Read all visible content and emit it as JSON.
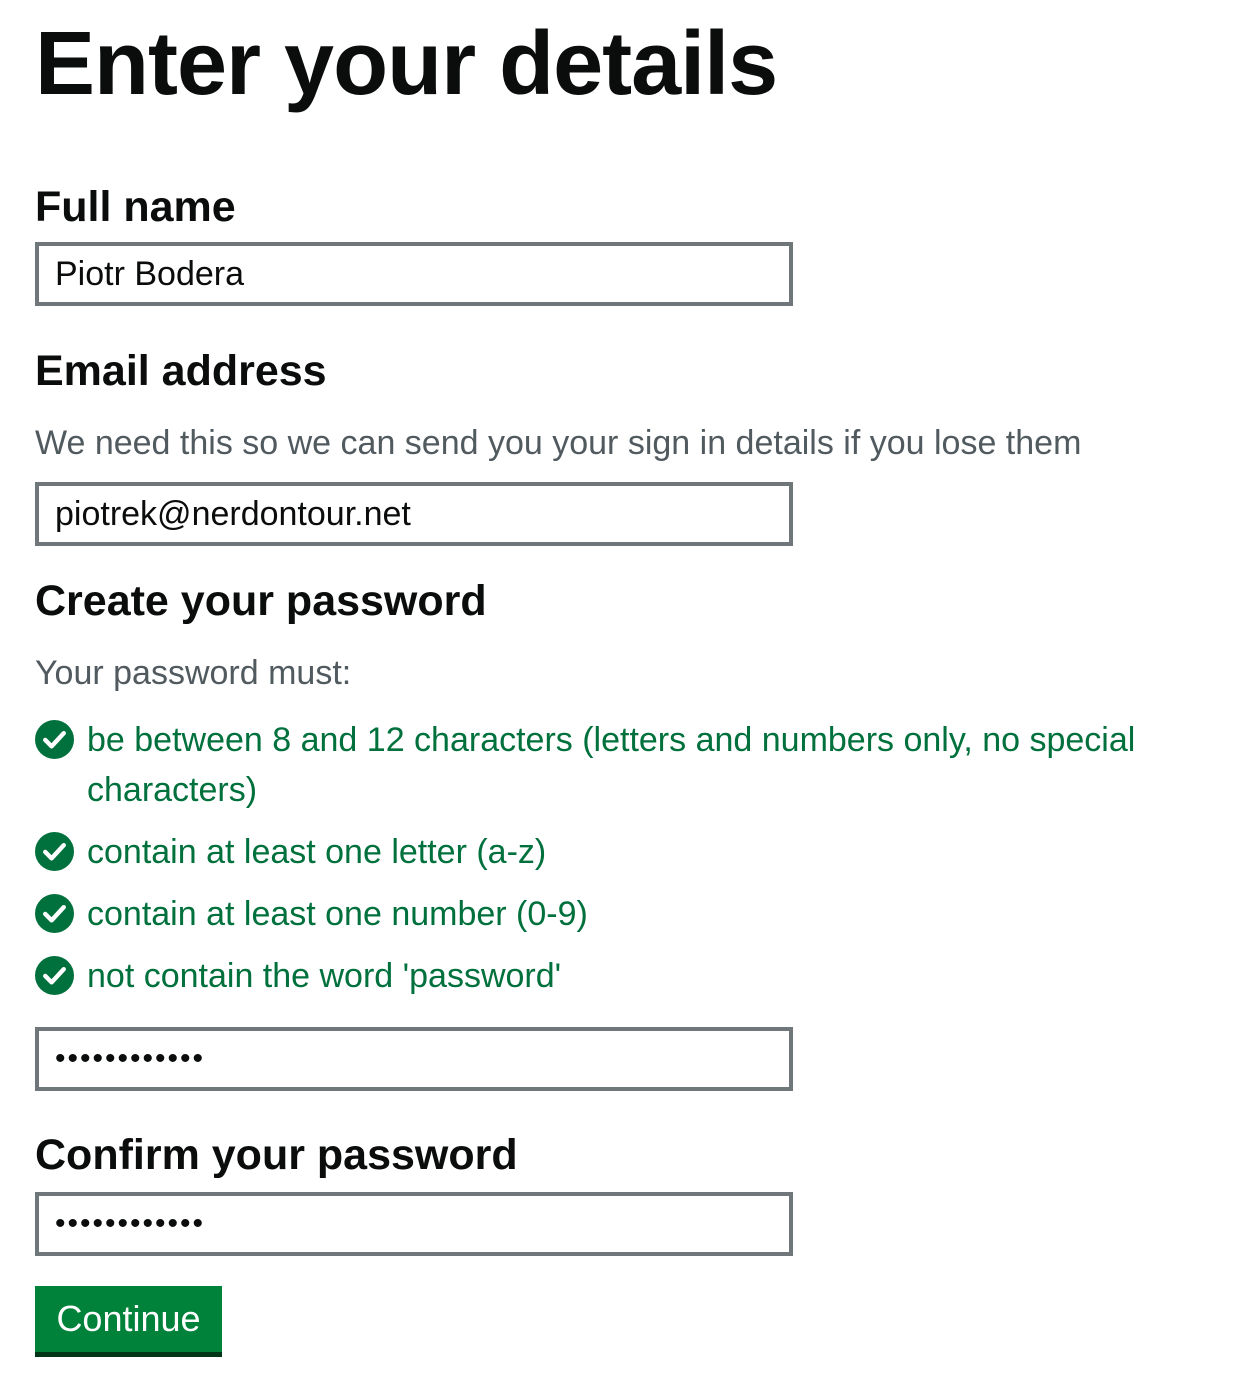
{
  "page": {
    "title": "Enter your details"
  },
  "full_name": {
    "label": "Full name",
    "value": "Piotr Bodera"
  },
  "email": {
    "label": "Email address",
    "hint": "We need this so we can send you your sign in details if you lose them",
    "value": "piotrek@nerdontour.net"
  },
  "password": {
    "label": "Create your password",
    "hint": "Your password must:",
    "requirements": [
      {
        "text": "be between 8 and 12 characters (letters and numbers only, no special characters)",
        "icon": "check-circle-icon",
        "met": true
      },
      {
        "text": "contain at least one letter (a-z)",
        "icon": "check-circle-icon",
        "met": true
      },
      {
        "text": "contain at least one number (0-9)",
        "icon": "check-circle-icon",
        "met": true
      },
      {
        "text": "not contain the word 'password'",
        "icon": "check-circle-icon",
        "met": true
      }
    ],
    "masked_value": "••••••••••••"
  },
  "confirm_password": {
    "label": "Confirm your password",
    "masked_value": "••••••••••••"
  },
  "actions": {
    "continue_label": "Continue"
  },
  "colors": {
    "text": "#0b0c0c",
    "hint": "#505a5f",
    "success": "#00703c",
    "button": "#00823b",
    "button_shadow": "#003618",
    "input_border": "#6f777b"
  }
}
